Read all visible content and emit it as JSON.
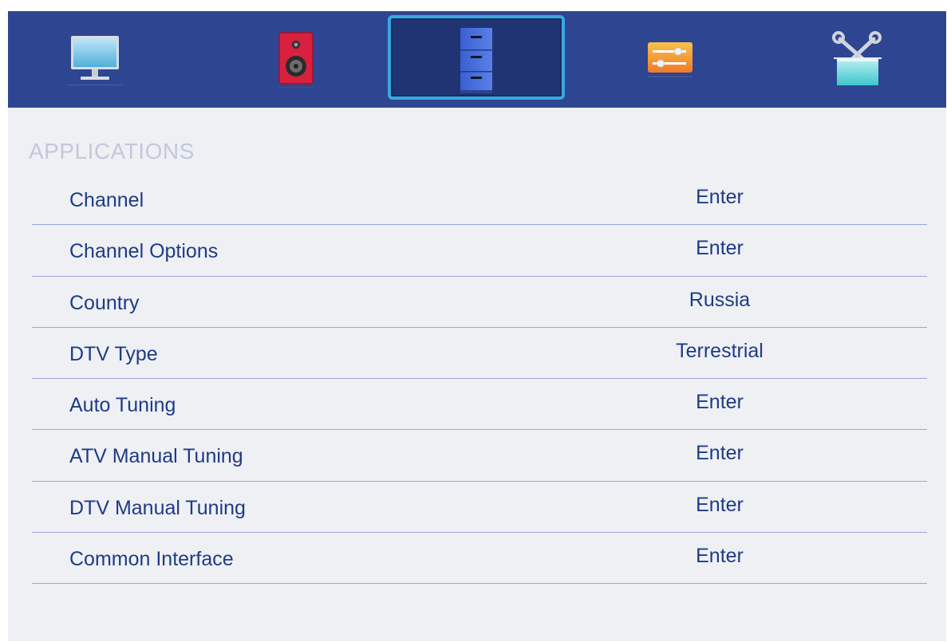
{
  "tabs": [
    {
      "id": "picture",
      "icon": "tv-monitor-icon",
      "active": false
    },
    {
      "id": "sound",
      "icon": "speaker-icon",
      "active": false
    },
    {
      "id": "applications",
      "icon": "cabinet-icon",
      "active": true
    },
    {
      "id": "settings",
      "icon": "sliders-icon",
      "active": false
    },
    {
      "id": "tools",
      "icon": "tools-icon",
      "active": false
    }
  ],
  "section": {
    "title": "APPLICATIONS"
  },
  "items": [
    {
      "label": "Channel",
      "value": "Enter"
    },
    {
      "label": "Channel Options",
      "value": "Enter"
    },
    {
      "label": "Country",
      "value": "Russia"
    },
    {
      "label": "DTV Type",
      "value": "Terrestrial"
    },
    {
      "label": "Auto Tuning",
      "value": "Enter"
    },
    {
      "label": "ATV Manual Tuning",
      "value": "Enter"
    },
    {
      "label": "DTV Manual Tuning",
      "value": "Enter"
    },
    {
      "label": "Common Interface",
      "value": "Enter"
    }
  ],
  "colors": {
    "tab_bar": "#2e4591",
    "active_frame": "#38a8e0",
    "panel_bg": "#eef0f4",
    "text": "#1f3b86",
    "section_title": "#c3c8dc",
    "divider": "#9aa8cf"
  }
}
